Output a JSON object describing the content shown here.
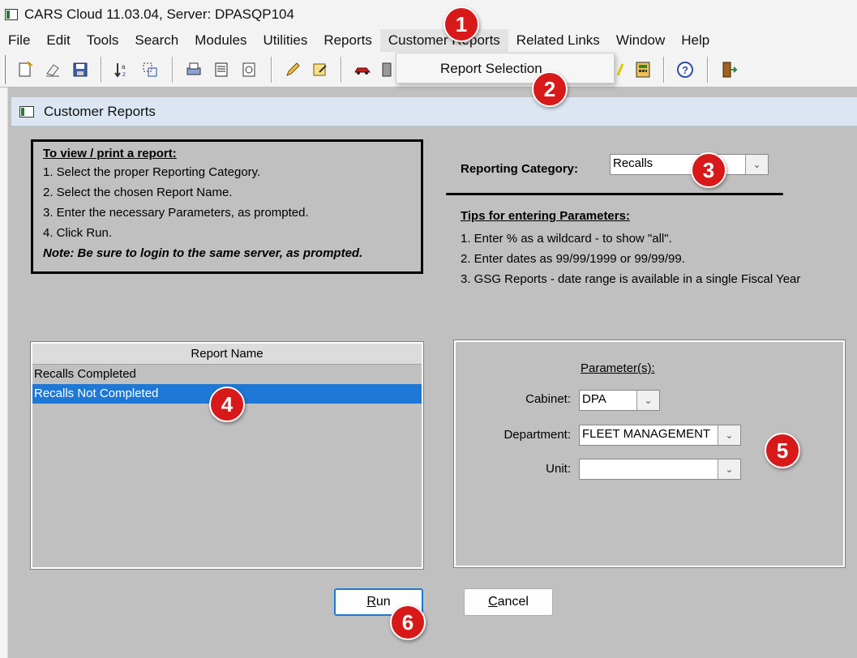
{
  "window": {
    "title": "CARS Cloud 11.03.04, Server: DPASQP104",
    "icon": "app-window-icon"
  },
  "menubar": {
    "items": [
      "File",
      "Edit",
      "Tools",
      "Search",
      "Modules",
      "Utilities",
      "Reports",
      "Customer Reports",
      "Related Links",
      "Window",
      "Help"
    ]
  },
  "dropdown": {
    "item": "Report Selection"
  },
  "child_window": {
    "title": "Customer Reports"
  },
  "instructions": {
    "title": "To view / print a report:",
    "steps": [
      "1.  Select the proper Reporting Category.",
      "2.  Select the chosen Report Name.",
      "3.  Enter the necessary Parameters, as prompted.",
      "4.  Click Run."
    ],
    "note": "Note:  Be sure to login to the same server, as prompted."
  },
  "reporting_category": {
    "label": "Reporting Category:",
    "value": "Recalls"
  },
  "tips": {
    "title": "Tips for entering Parameters:",
    "items": [
      "1.  Enter % as a wildcard - to show \"all\".",
      "2.  Enter dates as  99/99/1999  or  99/99/99.",
      "3.  GSG Reports - date range is available in a single Fiscal Year"
    ]
  },
  "report_list": {
    "header": "Report Name",
    "rows": [
      "Recalls Completed",
      "Recalls Not Completed"
    ],
    "selected_index": 1
  },
  "parameters": {
    "title": "Parameter(s):",
    "cabinet": {
      "label": "Cabinet:",
      "value": "DPA"
    },
    "department": {
      "label": "Department:",
      "value": "FLEET MANAGEMENT"
    },
    "unit": {
      "label": "Unit:",
      "value": ""
    }
  },
  "buttons": {
    "run_prefix": "R",
    "run_rest": "un",
    "cancel_prefix": "C",
    "cancel_rest": "ancel"
  },
  "badges": [
    "1",
    "2",
    "3",
    "4",
    "5",
    "6"
  ],
  "colors": {
    "selection": "#1e78d6",
    "badge": "#d81919",
    "child_titlebar": "#dce6f3"
  }
}
